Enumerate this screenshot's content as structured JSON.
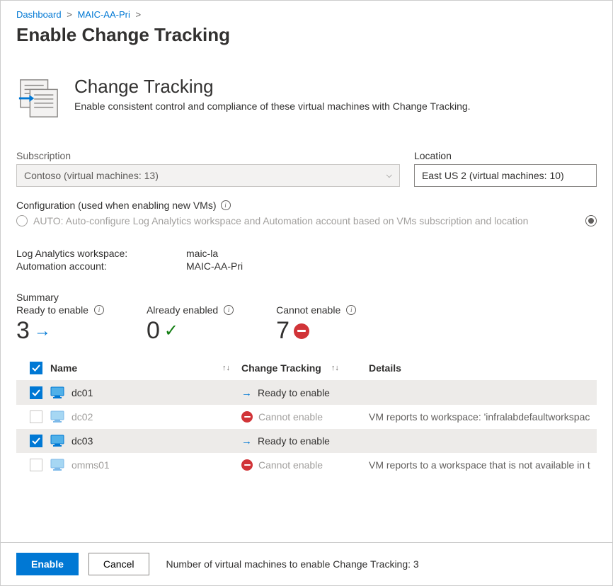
{
  "breadcrumb": {
    "item1": "Dashboard",
    "item2": "MAIC-AA-Pri"
  },
  "page_title": "Enable Change Tracking",
  "hero": {
    "title": "Change Tracking",
    "subtitle": "Enable consistent control and compliance of these virtual machines with Change Tracking."
  },
  "subscription": {
    "label": "Subscription",
    "value": "Contoso  (virtual machines: 13)"
  },
  "location": {
    "label": "Location",
    "value": "East US 2 (virtual machines: 10)"
  },
  "config": {
    "label": "Configuration (used when enabling new VMs)",
    "option_auto": "AUTO: Auto-configure Log Analytics workspace and Automation account based on VMs subscription and location"
  },
  "workspace": {
    "law_label": "Log Analytics workspace:",
    "law_value": "maic-la",
    "aa_label": "Automation account:",
    "aa_value": "MAIC-AA-Pri"
  },
  "summary": {
    "label": "Summary",
    "ready_label": "Ready to enable",
    "ready_count": "3",
    "already_label": "Already enabled",
    "already_count": "0",
    "cannot_label": "Cannot enable",
    "cannot_count": "7"
  },
  "table": {
    "col_name": "Name",
    "col_status": "Change Tracking",
    "col_details": "Details",
    "rows": [
      {
        "name": "dc01",
        "status": "Ready to enable",
        "details": "",
        "checked": true,
        "enabled": true
      },
      {
        "name": "dc02",
        "status": "Cannot enable",
        "details": "VM reports to workspace: 'infralabdefaultworkspac",
        "checked": false,
        "enabled": false
      },
      {
        "name": "dc03",
        "status": "Ready to enable",
        "details": "",
        "checked": true,
        "enabled": true
      },
      {
        "name": "omms01",
        "status": "Cannot enable",
        "details": "VM reports to a workspace that is not available in t",
        "checked": false,
        "enabled": false
      }
    ]
  },
  "footer": {
    "enable": "Enable",
    "cancel": "Cancel",
    "status": "Number of virtual machines to enable Change Tracking: 3"
  }
}
